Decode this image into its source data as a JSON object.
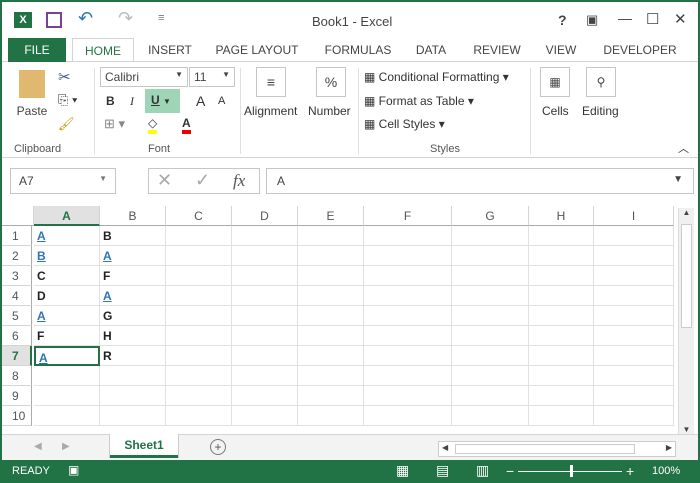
{
  "title": "Book1 - Excel",
  "window_controls": {
    "help": "?",
    "restore": "▣",
    "minimize": "—",
    "maximize": "☐",
    "close": "✕"
  },
  "qat": {
    "undo": "↶",
    "redo": "↷"
  },
  "tabs": [
    "FILE",
    "HOME",
    "INSERT",
    "PAGE LAYOUT",
    "FORMULAS",
    "DATA",
    "REVIEW",
    "VIEW",
    "DEVELOPER"
  ],
  "ribbon": {
    "paste": "Paste",
    "clipboard": "Clipboard",
    "font_name": "Calibri",
    "font_size": "11",
    "bold": "B",
    "italic": "I",
    "underline": "U",
    "grow": "A",
    "shrink": "A",
    "font_color": "A",
    "font": "Font",
    "alignment": "Alignment",
    "number": "Number",
    "percent": "%",
    "conditional": "Conditional Formatting",
    "format_table": "Format as Table",
    "cell_styles": "Cell Styles",
    "styles": "Styles",
    "cells": "Cells",
    "editing": "Editing"
  },
  "formula_bar": {
    "name_box": "A7",
    "fx": "fx",
    "content": "A"
  },
  "columns": [
    "A",
    "B",
    "C",
    "D",
    "E",
    "F",
    "G",
    "H",
    "I"
  ],
  "rows": [
    "1",
    "2",
    "3",
    "4",
    "5",
    "6",
    "7",
    "8",
    "9",
    "10"
  ],
  "cells": [
    [
      {
        "v": "A",
        "link": true
      },
      {
        "v": "B"
      }
    ],
    [
      {
        "v": "B",
        "link": true
      },
      {
        "v": "A",
        "link": true
      }
    ],
    [
      {
        "v": "C"
      },
      {
        "v": "F"
      }
    ],
    [
      {
        "v": "D"
      },
      {
        "v": "A",
        "link": true
      }
    ],
    [
      {
        "v": "A",
        "link": true
      },
      {
        "v": "G"
      }
    ],
    [
      {
        "v": "F"
      },
      {
        "v": "H"
      }
    ],
    [
      {
        "v": "A",
        "link": true
      },
      {
        "v": "R"
      }
    ]
  ],
  "selected": "A7",
  "sheet_tab": "Sheet1",
  "status": {
    "ready": "READY",
    "zoom": "100%",
    "minus": "−",
    "plus": "+"
  },
  "accent": "#217346"
}
